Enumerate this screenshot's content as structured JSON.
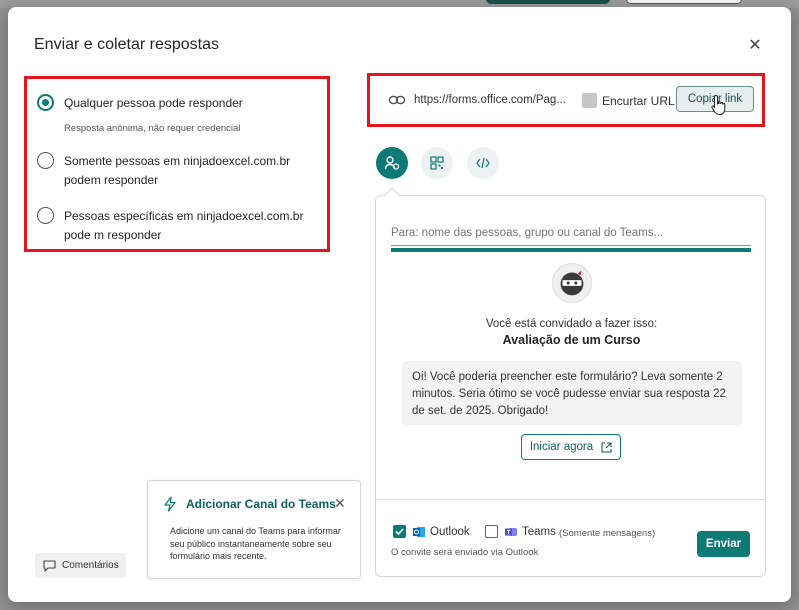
{
  "dialog": {
    "title": "Enviar e coletar respostas",
    "close_glyph": "✕"
  },
  "audience": {
    "options": [
      {
        "label": "Qualquer pessoa pode responder",
        "selected": true
      },
      {
        "label": "Somente pessoas em ninjadoexcel.com.br podem responder",
        "selected": false
      },
      {
        "label": "Pessoas específicas em ninjadoexcel.com.br pode m responder",
        "selected": false
      }
    ],
    "anonymous_note": "Resposta anônima, não requer credencial"
  },
  "link": {
    "url": "https://forms.office.com/Pag...",
    "shorten_label": "Encurtar URL",
    "shorten_checked": false,
    "copy_label": "Copiar link"
  },
  "share_tabs": [
    {
      "icon": "people-icon",
      "active": true
    },
    {
      "icon": "qr-code-icon",
      "active": false
    },
    {
      "icon": "embed-code-icon",
      "active": false
    }
  ],
  "invite": {
    "recipients_placeholder": "Para: nome das pessoas, grupo ou canal do Teams...",
    "invited_text": "Você está convidado a fazer isso:",
    "form_title": "Avaliação de um Curso",
    "message": "Oi! Você poderia preencher este formulário? Leva somente 2 minutos. Seria ótimo se você pudesse enviar sua resposta 22 de set. de 2025. Obrigado!",
    "start_label": "Iniciar agora",
    "channels": [
      {
        "label": "Outlook",
        "checked": true
      },
      {
        "label": "Teams",
        "checked": false,
        "note": "(Somente mensagens)"
      }
    ],
    "footer_note": "O convite será enviado via Outlook",
    "send_label": "Enviar"
  },
  "teams_popup": {
    "title": "Adicionar Canal do Teams",
    "body": "Adicione um canal do Teams para informar seu público instantaneamente sobre seu formulário mais recente."
  },
  "comments_label": "Comentários",
  "colors": {
    "accent": "#0e7a76",
    "highlight_border": "#e8141c"
  }
}
